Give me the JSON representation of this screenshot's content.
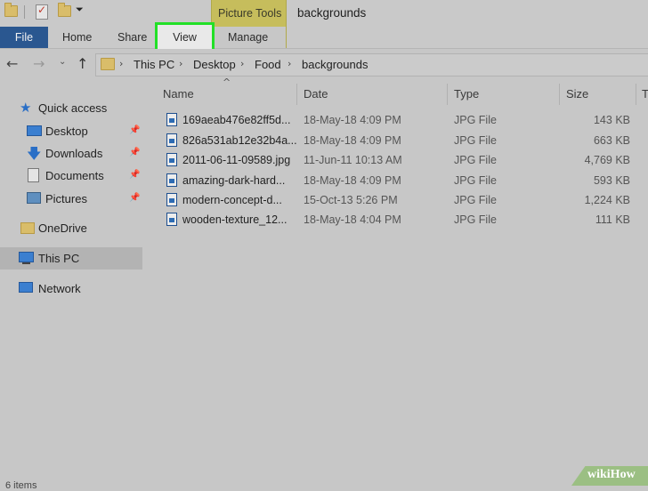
{
  "window": {
    "title": "backgrounds",
    "context_tab_label": "Picture Tools"
  },
  "ribbon": {
    "tabs": [
      {
        "label": "File"
      },
      {
        "label": "Home"
      },
      {
        "label": "Share"
      },
      {
        "label": "View"
      },
      {
        "label": "Manage"
      }
    ]
  },
  "address": {
    "crumbs": [
      "This PC",
      "Desktop",
      "Food",
      "backgrounds"
    ]
  },
  "sidebar": {
    "quick_access": "Quick access",
    "items": [
      {
        "label": "Desktop",
        "icon": "desktop-icon"
      },
      {
        "label": "Downloads",
        "icon": "download-icon"
      },
      {
        "label": "Documents",
        "icon": "documents-icon"
      },
      {
        "label": "Pictures",
        "icon": "pictures-icon"
      }
    ],
    "onedrive": "OneDrive",
    "this_pc": "This PC",
    "network": "Network"
  },
  "columns": {
    "name": "Name",
    "date": "Date",
    "type": "Type",
    "size": "Size",
    "tags": "T"
  },
  "files": [
    {
      "name": "169aeab476e82ff5d...",
      "date": "18-May-18 4:09 PM",
      "type": "JPG File",
      "size": "143 KB"
    },
    {
      "name": "826a531ab12e32b4a...",
      "date": "18-May-18 4:09 PM",
      "type": "JPG File",
      "size": "663 KB"
    },
    {
      "name": "2011-06-11-09589.jpg",
      "date": "11-Jun-11 10:13 AM",
      "type": "JPG File",
      "size": "4,769 KB"
    },
    {
      "name": "amazing-dark-hard...",
      "date": "18-May-18 4:09 PM",
      "type": "JPG File",
      "size": "593 KB"
    },
    {
      "name": "modern-concept-d...",
      "date": "15-Oct-13 5:26 PM",
      "type": "JPG File",
      "size": "1,224 KB"
    },
    {
      "name": "wooden-texture_12...",
      "date": "18-May-18 4:04 PM",
      "type": "JPG File",
      "size": "111 KB"
    }
  ],
  "status": {
    "text": "6 items"
  },
  "watermark": {
    "text": "wikiHow"
  },
  "colors": {
    "highlight": "#22e027",
    "file_tab": "#2a5790",
    "context_tab": "#c6bd5c",
    "selection": "#b3b3b3"
  }
}
